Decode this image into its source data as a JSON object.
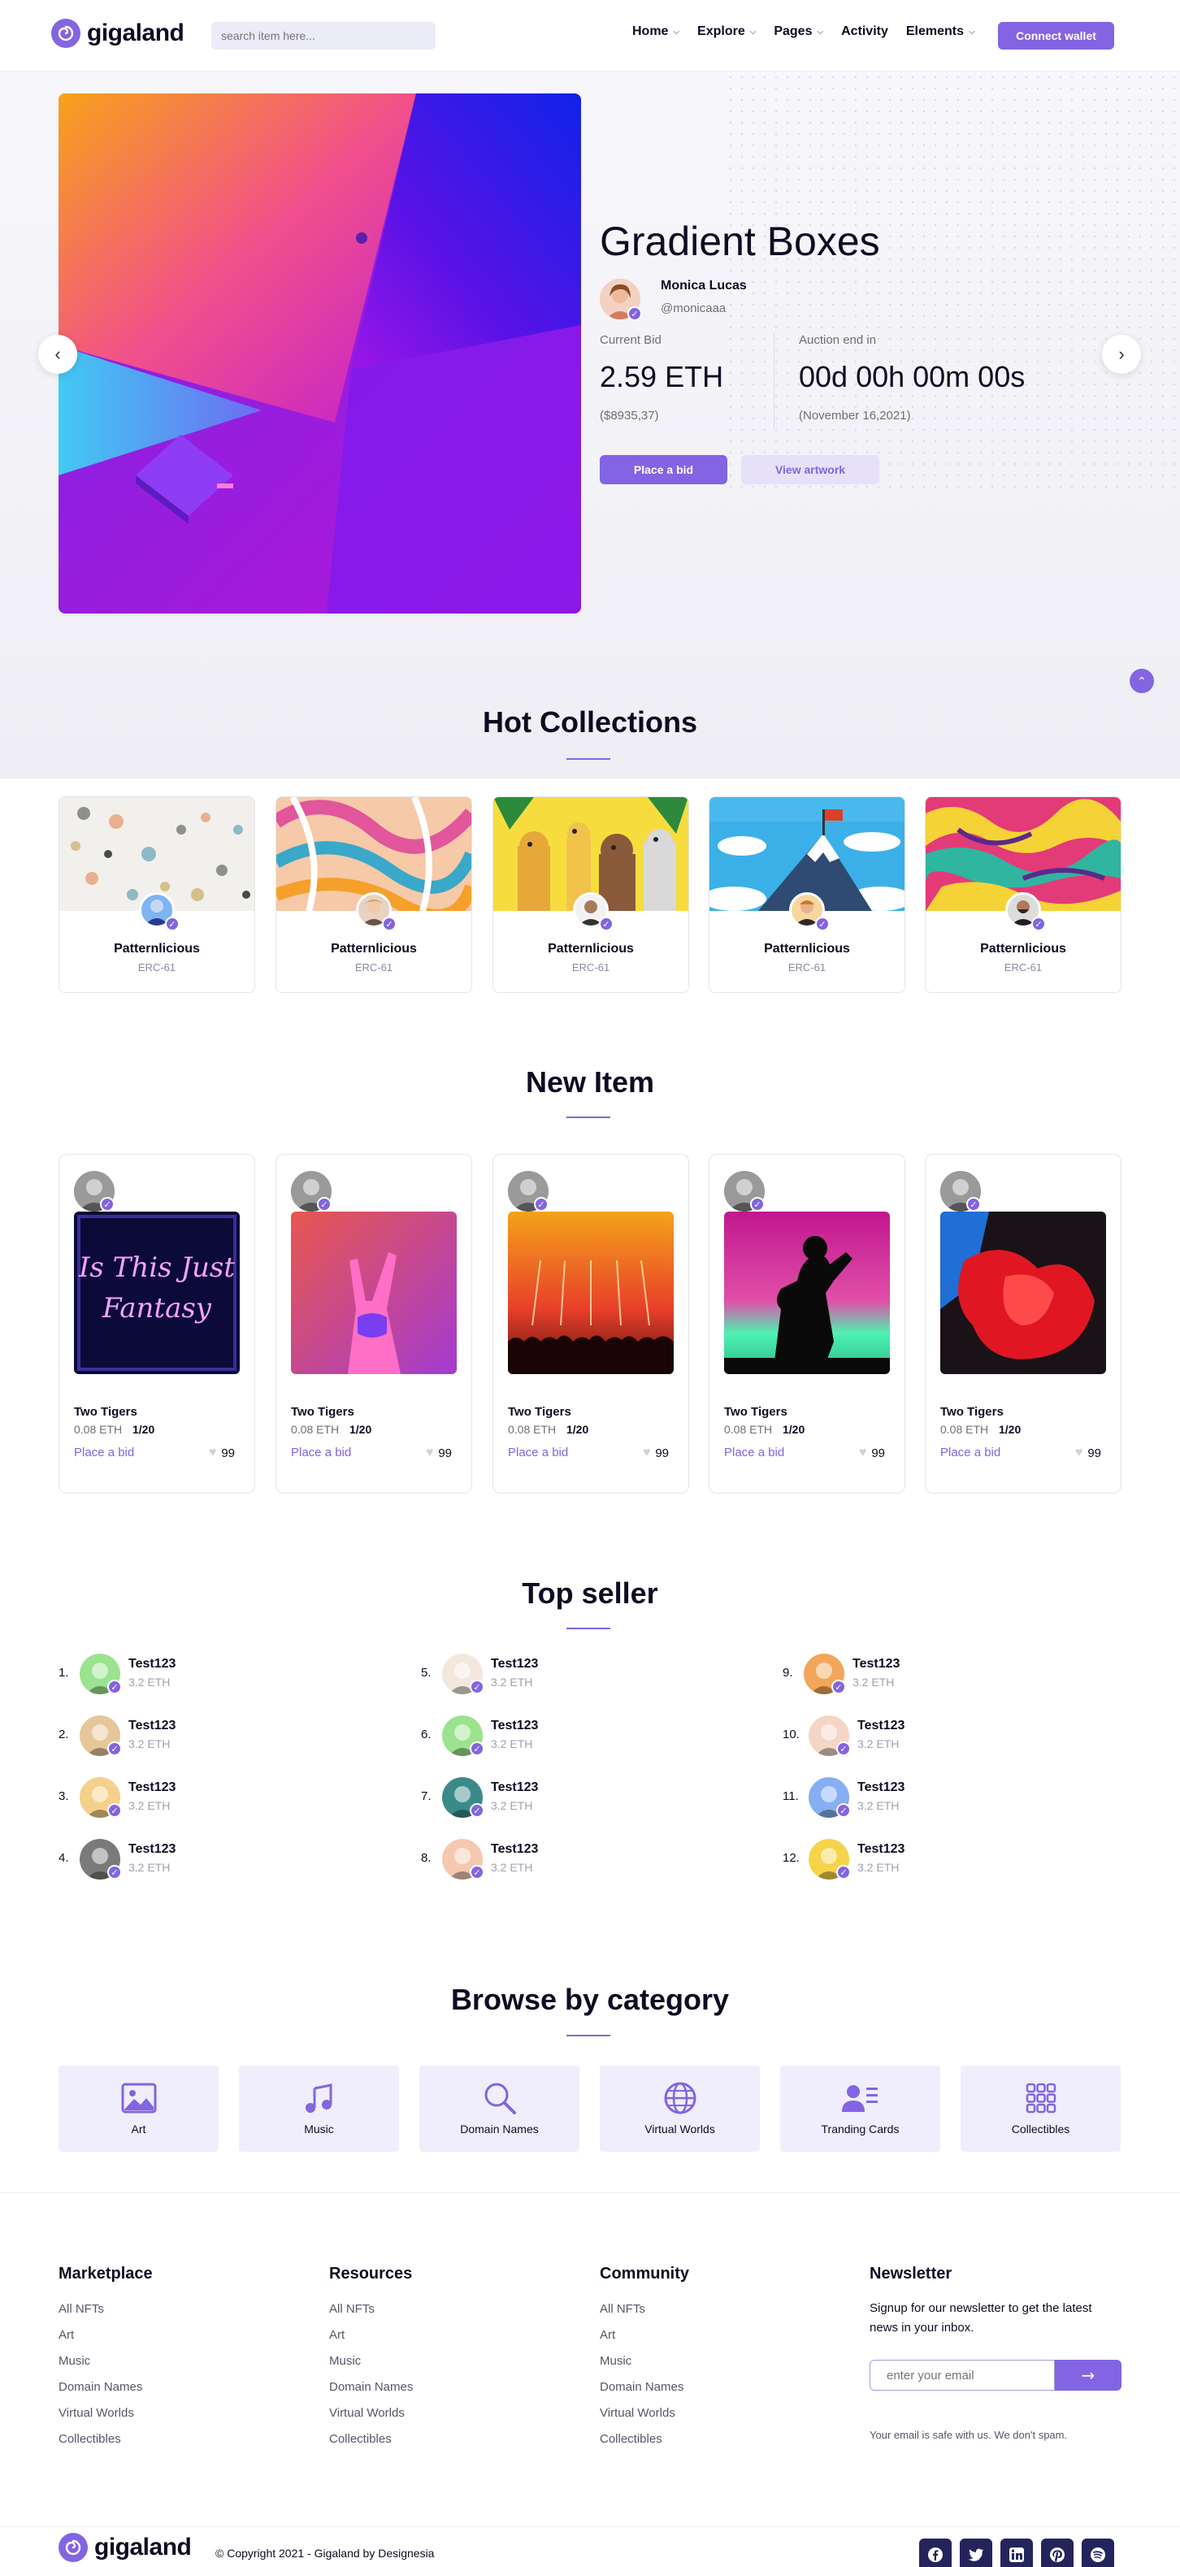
{
  "brand": {
    "name": "gigaland"
  },
  "header": {
    "search_placeholder": "search item here...",
    "nav": [
      {
        "label": "Home",
        "has_dropdown": true
      },
      {
        "label": "Explore",
        "has_dropdown": true
      },
      {
        "label": "Pages",
        "has_dropdown": true
      },
      {
        "label": "Activity",
        "has_dropdown": false
      },
      {
        "label": "Elements",
        "has_dropdown": true
      }
    ],
    "connect_label": "Connect wallet"
  },
  "hero": {
    "title": "Gradient Boxes",
    "author_name": "Monica Lucas",
    "author_handle": "@monicaaa",
    "current_bid_label": "Current Bid",
    "current_bid_value": "2.59 ETH",
    "current_bid_usd": "($8935,37)",
    "auction_label": "Auction end in",
    "auction_value": "00d 00h 00m 00s",
    "auction_date": "(November 16,2021)",
    "place_bid_label": "Place a bid",
    "view_artwork_label": "View artwork"
  },
  "hot_collections": {
    "title": "Hot Collections",
    "items": [
      {
        "name": "Patternlicious",
        "sub": "ERC-61"
      },
      {
        "name": "Patternlicious",
        "sub": "ERC-61"
      },
      {
        "name": "Patternlicious",
        "sub": "ERC-61"
      },
      {
        "name": "Patternlicious",
        "sub": "ERC-61"
      },
      {
        "name": "Patternlicious",
        "sub": "ERC-61"
      }
    ]
  },
  "new_items": {
    "title": "New Item",
    "items": [
      {
        "name": "Two Tigers",
        "price": "0.08 ETH",
        "qty": "1/20",
        "bid_label": "Place a bid",
        "likes": "99",
        "neon_text": "Is This Just Fantasy"
      },
      {
        "name": "Two Tigers",
        "price": "0.08 ETH",
        "qty": "1/20",
        "bid_label": "Place a bid",
        "likes": "99"
      },
      {
        "name": "Two Tigers",
        "price": "0.08 ETH",
        "qty": "1/20",
        "bid_label": "Place a bid",
        "likes": "99"
      },
      {
        "name": "Two Tigers",
        "price": "0.08 ETH",
        "qty": "1/20",
        "bid_label": "Place a bid",
        "likes": "99"
      },
      {
        "name": "Two Tigers",
        "price": "0.08 ETH",
        "qty": "1/20",
        "bid_label": "Place a bid",
        "likes": "99"
      }
    ]
  },
  "top_seller": {
    "title": "Top seller",
    "sellers": [
      {
        "rank": "1.",
        "name": "Test123",
        "eth": "3.2 ETH"
      },
      {
        "rank": "2.",
        "name": "Test123",
        "eth": "3.2 ETH"
      },
      {
        "rank": "3.",
        "name": "Test123",
        "eth": "3.2 ETH"
      },
      {
        "rank": "4.",
        "name": "Test123",
        "eth": "3.2 ETH"
      },
      {
        "rank": "5.",
        "name": "Test123",
        "eth": "3.2 ETH"
      },
      {
        "rank": "6.",
        "name": "Test123",
        "eth": "3.2 ETH"
      },
      {
        "rank": "7.",
        "name": "Test123",
        "eth": "3.2 ETH"
      },
      {
        "rank": "8.",
        "name": "Test123",
        "eth": "3.2 ETH"
      },
      {
        "rank": "9.",
        "name": "Test123",
        "eth": "3.2 ETH"
      },
      {
        "rank": "10.",
        "name": "Test123",
        "eth": "3.2 ETH"
      },
      {
        "rank": "11.",
        "name": "Test123",
        "eth": "3.2 ETH"
      },
      {
        "rank": "12.",
        "name": "Test123",
        "eth": "3.2 ETH"
      }
    ]
  },
  "categories": {
    "title": "Browse by category",
    "items": [
      {
        "label": "Art",
        "icon": "image-icon"
      },
      {
        "label": "Music",
        "icon": "music-icon"
      },
      {
        "label": "Domain Names",
        "icon": "search-icon"
      },
      {
        "label": "Virtual Worlds",
        "icon": "globe-icon"
      },
      {
        "label": "Tranding Cards",
        "icon": "id-card-icon"
      },
      {
        "label": "Collectibles",
        "icon": "grid-icon"
      }
    ]
  },
  "footer": {
    "columns": [
      {
        "title": "Marketplace",
        "links": [
          "All NFTs",
          "Art",
          "Music",
          "Domain Names",
          "Virtual Worlds",
          "Collectibles"
        ]
      },
      {
        "title": "Resources",
        "links": [
          "All NFTs",
          "Art",
          "Music",
          "Domain Names",
          "Virtual Worlds",
          "Collectibles"
        ]
      },
      {
        "title": "Community",
        "links": [
          "All NFTs",
          "Art",
          "Music",
          "Domain Names",
          "Virtual Worlds",
          "Collectibles"
        ]
      }
    ],
    "newsletter": {
      "title": "Newsletter",
      "text": "Signup for our newsletter to get the latest news in your inbox.",
      "placeholder": "enter your email",
      "note": "Your email is safe with us. We don't spam."
    },
    "copyright": "© Copyright 2021 - Gigaland by Designesia",
    "social": [
      "facebook-icon",
      "twitter-icon",
      "linkedin-icon",
      "pinterest-icon",
      "rss-icon"
    ]
  },
  "colors": {
    "accent": "#8364e2",
    "dark": "#0d0c22",
    "social_bg": "#23245c",
    "category_bg": "#f0eefc"
  }
}
